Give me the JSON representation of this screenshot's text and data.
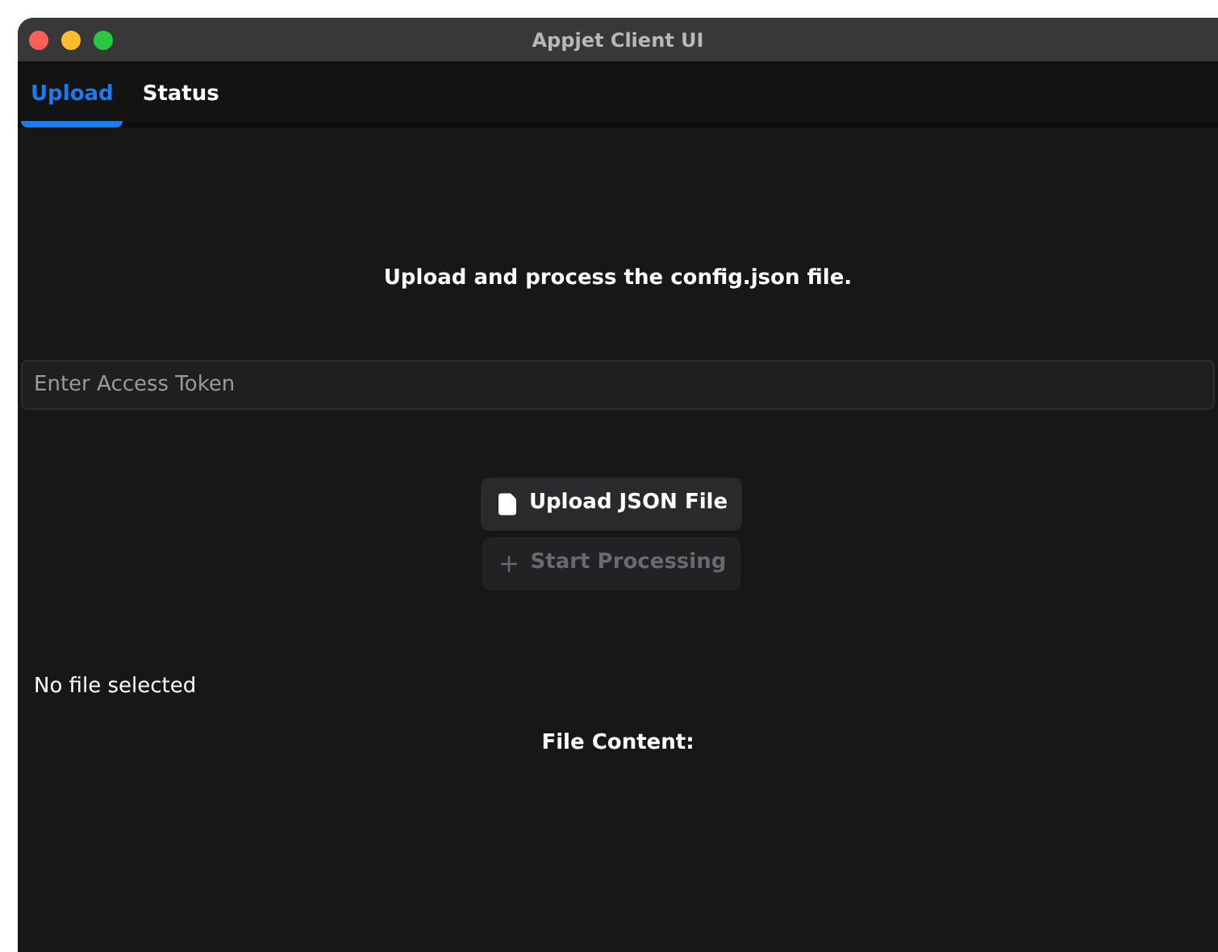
{
  "window": {
    "title": "Appjet Client UI"
  },
  "tabs": [
    {
      "label": "Upload",
      "selected": true
    },
    {
      "label": "Status",
      "selected": false
    }
  ],
  "heading": "Upload and process the config.json file.",
  "token_field": {
    "placeholder": "Enter Access Token"
  },
  "buttons": [
    {
      "kind": "upload",
      "label": "Upload JSON File",
      "disabled": false
    },
    {
      "kind": "start",
      "label": "Start Processing",
      "disabled": true
    }
  ],
  "file_status": "No file selected",
  "file_content_label": "File Content:"
}
